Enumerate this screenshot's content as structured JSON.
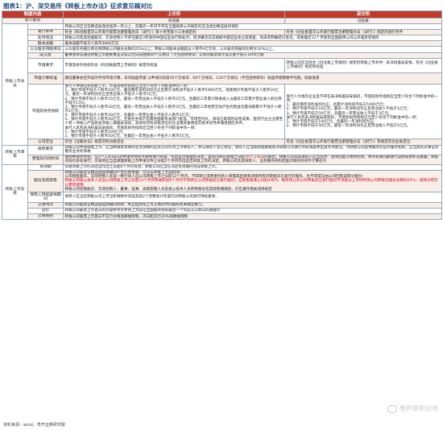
{
  "title": "图表1：沪、深交易所《转板上市办法》征求意见稿对比",
  "header": {
    "col1": "制度内容",
    "col2": "上交所",
    "col3": "深交所"
  },
  "board": {
    "sse": "科创板",
    "szse": "创业板",
    "label": "转入板块"
  },
  "cats": {
    "conditions": "转板上市条件",
    "review": "转板上市审核",
    "arrange": "转板上市安排"
  },
  "rows": {
    "r1": {
      "sub": "",
      "sse": "转板公司应当在精选层连续挂牌一年以上，且最近一年内不存在全国股转公司规定的应当调出精选层的情形"
    },
    "r2": {
      "sub": "发行条件",
      "sse": "符合《科创板首次公开发行股票注册管理办法（试行）》第十条至第十三条规定的",
      "szse": "符合《创业板首次公开发行股票注册管理办法（试行）》规定的发行条件"
    },
    "r3": {
      "sub": "处罚情况",
      "sse": "转板公司及其控股股东、实际控制人不存在最近3年受到中国证监会行政处罚，因涉嫌违法违规被中国证监会立案调查，尚未有明确结论意见，或者最近12个月受到全国股转公司公开谴责等情形"
    },
    "r4": {
      "sub": "股本总额",
      "sse": "股本总额不低于人民币3000万元"
    },
    "r5": {
      "sub": "公众股东持股情况",
      "sse": "公众股东持股比例达到转板公司股份总数的25%以上；转板公司股本总额超过人民币4亿元的，公众股东持股的比例为10%以上。"
    },
    "r6": {
      "sub": "成交量",
      "sse": "董事会审议通过转板上市相关事宜决议公告日前连续60个交易日（不包括停牌日）实现的股票累计成交量不低于1000万股"
    },
    "r7": {
      "sub": "市值要求",
      "sse": "市值及财务指标符合《科创板股票上市规则》规定的标准",
      "szse": "转板公司应当符合《创业板上市规则》规定的转板上市条件：表决权差异安排，符合《创业板上市规则》规定的标准"
    },
    "r8": {
      "sub": "市值计算标准",
      "sse": "顺延董事会召开前的平均市值计算，日均收盘市值 以申请日前第20个交易日、60个交易日、120个交易日（不包括停牌日）收盘市值算数平均值，取孰低值"
    },
    "r9": {
      "sub": "市值及财务指标",
      "sse": [
        "发行人申请在科创板上市，市值及财务指标应当至少符合下列标准中的一项：",
        "1、预计市值不低于人民币10亿元，最近两年净利润均为正且累计净利润不低于人民币5000万元，或者预计市值不低于人民币10亿元，最近一年净利润为正且营业收入不低于人民币1亿元；",
        "2、预计市值不低于人民币15亿元，最近一年营业收入不低于人民币2亿元，且最近三年累计研发投入占最近三年累计营业收入的比例不低于15%；",
        "3、预计市值不低于人民币20亿元，最近一年营业收入不低于人民币3亿元，且最近三年经营活动产生的现金流量净额累计不低于人民币1亿元；",
        "4、预计市值不低于人民币30亿元，且最近一年营业收入不低于人民币3亿元；",
        "5、预计市值不低于人民币40亿元，主要业务或产品需经国家有关部门批准，市场空间大，目前已取得阶段性成果。医药行业企业需至少有一项核心产品获准开展二期临床试验，其他符合科创板定位的企业需具备明显的技术优势并满足相应条件。",
        "发行人具有表决权差异安排的，市值及财务指标应当至少符合下列标准中的一项：",
        "1、预计市值不低于人民币100亿元；",
        "2、预计市值不低于人民币50亿元，且最近一年营业收入不低于人民币5亿元。"
      ],
      "szse": [
        "发行人为境内企业且不存在表决权差异安排的，市值及财务指标应当至少符合下列标准中的一项：",
        "1、最近两年净利润均为正，且累计净利润不低于5000万元；",
        "2、预计市值不低于10亿元，最近一年净利润为正且营业收入不低于1亿元；",
        "3、预计市值不低于50亿元，且最近一年营业收入不低于3亿元。",
        "发行人具有表决权差异安排的，市值及财务指标应当至少符合下列标准中的一项：",
        "1、预计市值不低于100亿元，且最近一年净利润为正；",
        "2、预计市值不低于50亿元，最近一年净利润为正且营业收入不低于5亿元。"
      ]
    },
    "r10": {
      "sub": "公司定位",
      "sse": "符合《注册办法》规定的科创板定位",
      "szse": "符合《创业板首次公开发行股票注册管理办法（试行）》等规定的创业板定位"
    },
    "r11": {
      "sub": "保荐要求",
      "sse": "转板公司申请转板上市，应当聘请具有保荐业务资格的证券公司作为上市保荐人，并与保荐人签订协议，保荐人应当按照相关规则对转板公司进行尽职调查并出具专项意见。为转板公司提供服务的证券服务机构，应当具有从事证券服务业务的资格"
    },
    "r12": {
      "sub": "受理及问询时间",
      "sse": [
        "收到申请文件后，在5个工作日内对申请文件的齐备性进行审查，作出是否受理的决定。",
        "首轮问询在受理之日起",
        "20个工作日",
        "内发出，转板公司及其保荐人应当及时、逐项回复交易所问询，并对有关问题进行说明或者补充披露；审核问询可多轮进行；交易所应当自受理转板上市申请文件之日起2个月内作出是否同意上市的决定，转板公司及其保荐人、证券服务机构回复问询的时间不计算在内"
      ]
    },
    "r13": {
      "sub": "有效期",
      "sse": "同意转板上市的决定自作出之日起6个月内有效，转板公司应当在决定有效期内完成转板上市。"
    },
    "r14": {
      "sub": "股份及其限售",
      "sse": [
        "转板公司股票在精选层挂牌期间产生的限售期，可以在转板上市后扣除；",
        "公司控股股东、实际控制人及其一致行动人自公司转板上市之日起12个月内，不得转让或者委托他人管理其直接和间接持有的转板前已发行的股份，也不得提议由公司回购该部分股份；",
        "转板公司核心技术人员",
        "自公司转板上市之日起12个月内和离职后6个月内不得转让公司转板前已发行股份；自限售期满之日起4年内，每年转让的公司转板前已发行股份不得超过上市时所持公司转板前股份总数的25%，减持比例可以累积使用。",
        "转板公司控股股东、实际控制人、董事、监事、高级管理人员及核心技术人员所持股份在其限售期满后，仍应遵守相关减持规定"
      ]
    },
    "r15": {
      "sub": "保荐人持续督导期间",
      "sse": "保荐人应当在转板公司上市当年剩余时间及其后2个完整会计年度内对转板公司进行持续督导。"
    },
    "r16": {
      "sub": "交易时间",
      "sse": "转板公司股票在精选层挂牌期间停牌、终止挂牌及上市交易的时间按照有关规定执行。"
    },
    "r17": {
      "sub": "定价",
      "sse": "转板公司股票上市首日的开盘参考价原则上为其在全国股转系统最后一个有成交交易日的收盘价"
    },
    "r18": {
      "sub": "交易规则",
      "sse": "转板公司股票上市首日不实行价格涨跌幅限制，次日起实行20%涨跌幅限制"
    }
  },
  "source": "资料来源：wind、粤开证券研究院",
  "watermark": "粤开崇利论市"
}
